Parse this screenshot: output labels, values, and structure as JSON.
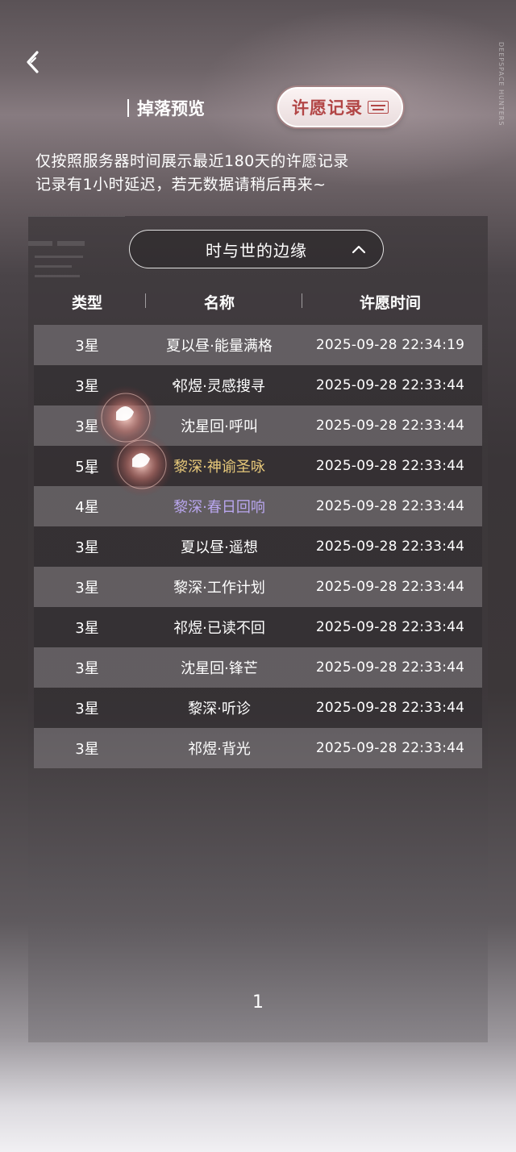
{
  "colors": {
    "rarity5": "#e8c97a",
    "rarity4": "#b9a6ee",
    "rarity3": "#ffffff",
    "tabActive": "#b24646"
  },
  "header": {
    "back_icon": "chevron-left-icon",
    "brand_vertical": "DEEPSPACE HUNTERS"
  },
  "tabs": {
    "drop_preview": "掉落预览",
    "wish_record": "许愿记录"
  },
  "notice": {
    "line1": "仅按照服务器时间展示最近180天的许愿记录",
    "line2": "记录有1小时延迟，若无数据请稍后再来~"
  },
  "pool_selector": {
    "value": "时与世的边缘",
    "icon": "chevron-up-icon"
  },
  "table": {
    "headers": {
      "type": "类型",
      "name": "名称",
      "time": "许愿时间"
    },
    "rows": [
      {
        "type": "3星",
        "name": "夏以昼·能量满格",
        "time": "2025-09-28 22:34:19",
        "rarity": 3
      },
      {
        "type": "3星",
        "name": "祁煜·灵感搜寻",
        "time": "2025-09-28 22:33:44",
        "rarity": 3
      },
      {
        "type": "3星",
        "name": "沈星回·呼叫",
        "time": "2025-09-28 22:33:44",
        "rarity": 3
      },
      {
        "type": "5星",
        "name": "黎深·神谕圣咏",
        "time": "2025-09-28 22:33:44",
        "rarity": 5
      },
      {
        "type": "4星",
        "name": "黎深·春日回响",
        "time": "2025-09-28 22:33:44",
        "rarity": 4
      },
      {
        "type": "3星",
        "name": "夏以昼·遥想",
        "time": "2025-09-28 22:33:44",
        "rarity": 3
      },
      {
        "type": "3星",
        "name": "黎深·工作计划",
        "time": "2025-09-28 22:33:44",
        "rarity": 3
      },
      {
        "type": "3星",
        "name": "祁煜·已读不回",
        "time": "2025-09-28 22:33:44",
        "rarity": 3
      },
      {
        "type": "3星",
        "name": "沈星回·锋芒",
        "time": "2025-09-28 22:33:44",
        "rarity": 3
      },
      {
        "type": "3星",
        "name": "黎深·听诊",
        "time": "2025-09-28 22:33:44",
        "rarity": 3
      },
      {
        "type": "3星",
        "name": "祁煜·背光",
        "time": "2025-09-28 22:33:44",
        "rarity": 3
      }
    ]
  },
  "pagination": {
    "current": "1"
  }
}
